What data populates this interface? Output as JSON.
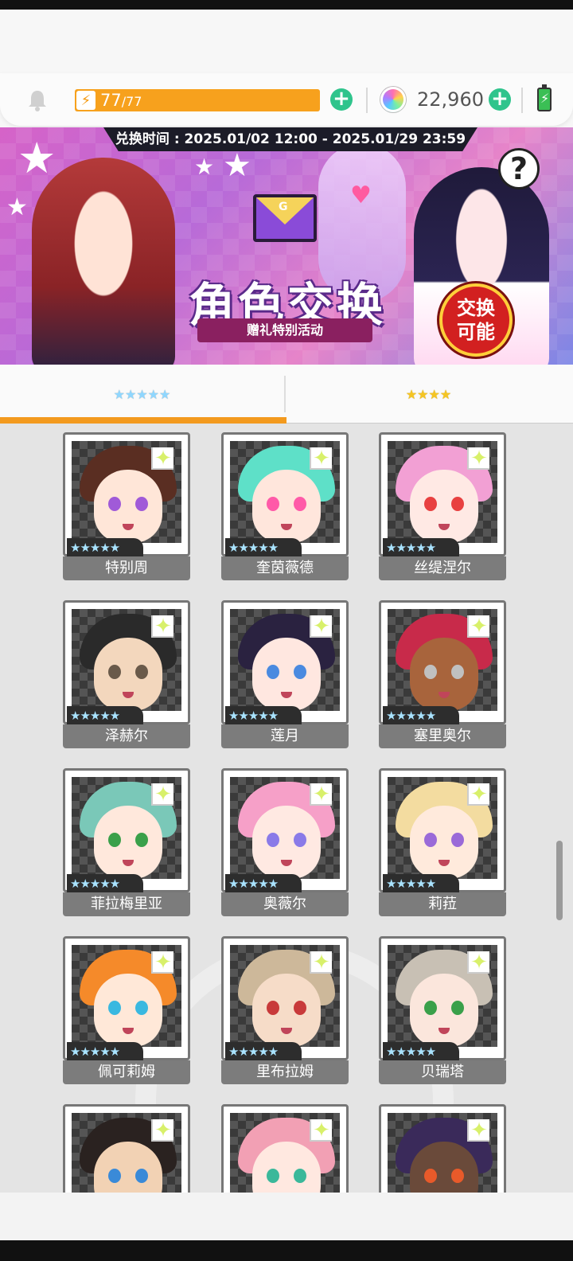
{
  "resources": {
    "stamina_current": "77",
    "stamina_max": "/77",
    "stamina_icon": "lightning-bolt",
    "gems": "22,960"
  },
  "banner": {
    "period": "兑换时间 : 2025.01/02 12:00 - 2025.01/29 23:59",
    "title": "角色交换",
    "subtitle": "赠礼特别活动",
    "badge": "交换可能",
    "help": "?"
  },
  "tabs": [
    {
      "label": "★★★★★",
      "active": true
    },
    {
      "label": "★★★★",
      "active": false
    }
  ],
  "characters": [
    {
      "name": "特别周",
      "stars": "★★★★★",
      "hair": "#5a2e22",
      "skin": "#ffe6d8",
      "eye": "#a05ad8"
    },
    {
      "name": "奎茵薇德",
      "stars": "★★★★★",
      "hair": "#5ee0c8",
      "skin": "#ffe6dc",
      "eye": "#ff5aa8"
    },
    {
      "name": "丝缇涅尔",
      "stars": "★★★★★",
      "hair": "#f2a0d4",
      "skin": "#ffe9e4",
      "eye": "#e84040"
    },
    {
      "name": "泽赫尔",
      "stars": "★★★★★",
      "hair": "#2a2a2a",
      "skin": "#f3d7bd",
      "eye": "#6a5a4a"
    },
    {
      "name": "莲月",
      "stars": "★★★★★",
      "hair": "#2a2240",
      "skin": "#ffe7e0",
      "eye": "#4a8ae0"
    },
    {
      "name": "塞里奥尔",
      "stars": "★★★★★",
      "hair": "#c82a4a",
      "skin": "#a8643c",
      "eye": "#c0c0c0"
    },
    {
      "name": "菲拉梅里亚",
      "stars": "★★★★★",
      "hair": "#7ac8b8",
      "skin": "#ffe8dc",
      "eye": "#3aa04a"
    },
    {
      "name": "奥薇尔",
      "stars": "★★★★★",
      "hair": "#f6a0c8",
      "skin": "#ffe9e2",
      "eye": "#8a7ae8"
    },
    {
      "name": "莉菈",
      "stars": "★★★★★",
      "hair": "#f3dca0",
      "skin": "#ffeadc",
      "eye": "#9a6ad8"
    },
    {
      "name": "佩可莉姆",
      "stars": "★★★★★",
      "hair": "#f58a2a",
      "skin": "#ffe8d8",
      "eye": "#3ab8e0"
    },
    {
      "name": "里布拉姆",
      "stars": "★★★★★",
      "hair": "#cdb89a",
      "skin": "#f6dcc8",
      "eye": "#c83a3a"
    },
    {
      "name": "贝瑞塔",
      "stars": "★★★★★",
      "hair": "#c8c0b4",
      "skin": "#fbe6dc",
      "eye": "#3aa04a"
    },
    {
      "name": "",
      "stars": "",
      "hair": "#2a2220",
      "skin": "#f2d2b4",
      "eye": "#3a8ad8"
    },
    {
      "name": "",
      "stars": "",
      "hair": "#f2a0b4",
      "skin": "#ffe8e0",
      "eye": "#3ab89a"
    },
    {
      "name": "",
      "stars": "",
      "hair": "#3a2a5a",
      "skin": "#6a4a3a",
      "eye": "#e85a2a"
    }
  ]
}
